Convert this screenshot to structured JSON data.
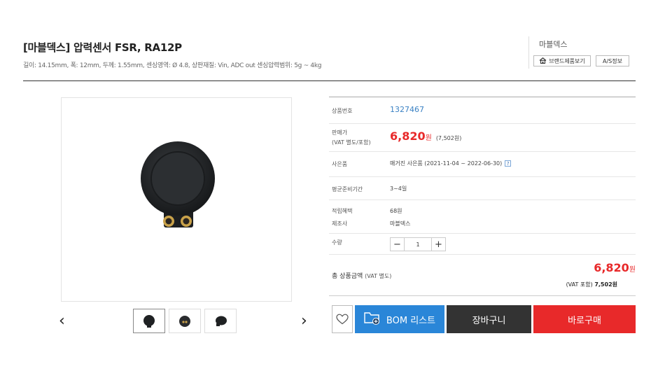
{
  "product": {
    "title": "[마블덱스] 압력센서 FSR, RA12P",
    "subtitle": "길이: 14.15mm, 폭: 12mm, 두께: 1.55mm, 센싱영역: Ø 4.8, 상판재질: Vin, ADC out 센싱압력범위: 5g ~ 4kg"
  },
  "brand": {
    "name": "마블덱스",
    "brand_products_label": "브랜드제품보기",
    "as_info_label": "A/S정보"
  },
  "gallery": {
    "prev_arrow": "‹",
    "next_arrow": "›"
  },
  "info": {
    "product_no_label": "상품번호",
    "product_no": "1327467",
    "price_label_1": "판매가",
    "price_label_2": "(VAT 별도/포함)",
    "price": "6,820",
    "price_unit": "원",
    "price_vat": "(7,502원)",
    "gift_label": "사은품",
    "gift_value": "매거진 사은품 (2021-11-04 ~ 2022-06-30)",
    "gift_help": "?",
    "lead_time_label": "평균준비기간",
    "lead_time": "3~4일",
    "points_label": "적립혜택",
    "points": "68원",
    "maker_label": "제조사",
    "maker": "마블덱스",
    "qty_label": "수량",
    "qty_minus": "−",
    "qty_value": "1",
    "qty_plus": "+"
  },
  "total": {
    "label": "총 상품금액",
    "label_note": "(VAT 별도)",
    "price": "6,820",
    "unit": "원",
    "vat_label": "(VAT 포함)",
    "vat_value": "7,502원"
  },
  "actions": {
    "bom_label": "BOM 리스트",
    "cart_label": "장바구니",
    "buy_label": "바로구매"
  },
  "colors": {
    "accent_red": "#e8292a",
    "bom_blue": "#2a86d8",
    "cart_dark": "#333333",
    "link_blue": "#3b82c4"
  },
  "icons": {
    "brand_button": "home-icon",
    "wishlist": "heart-icon",
    "bom": "folder-plus-icon"
  }
}
